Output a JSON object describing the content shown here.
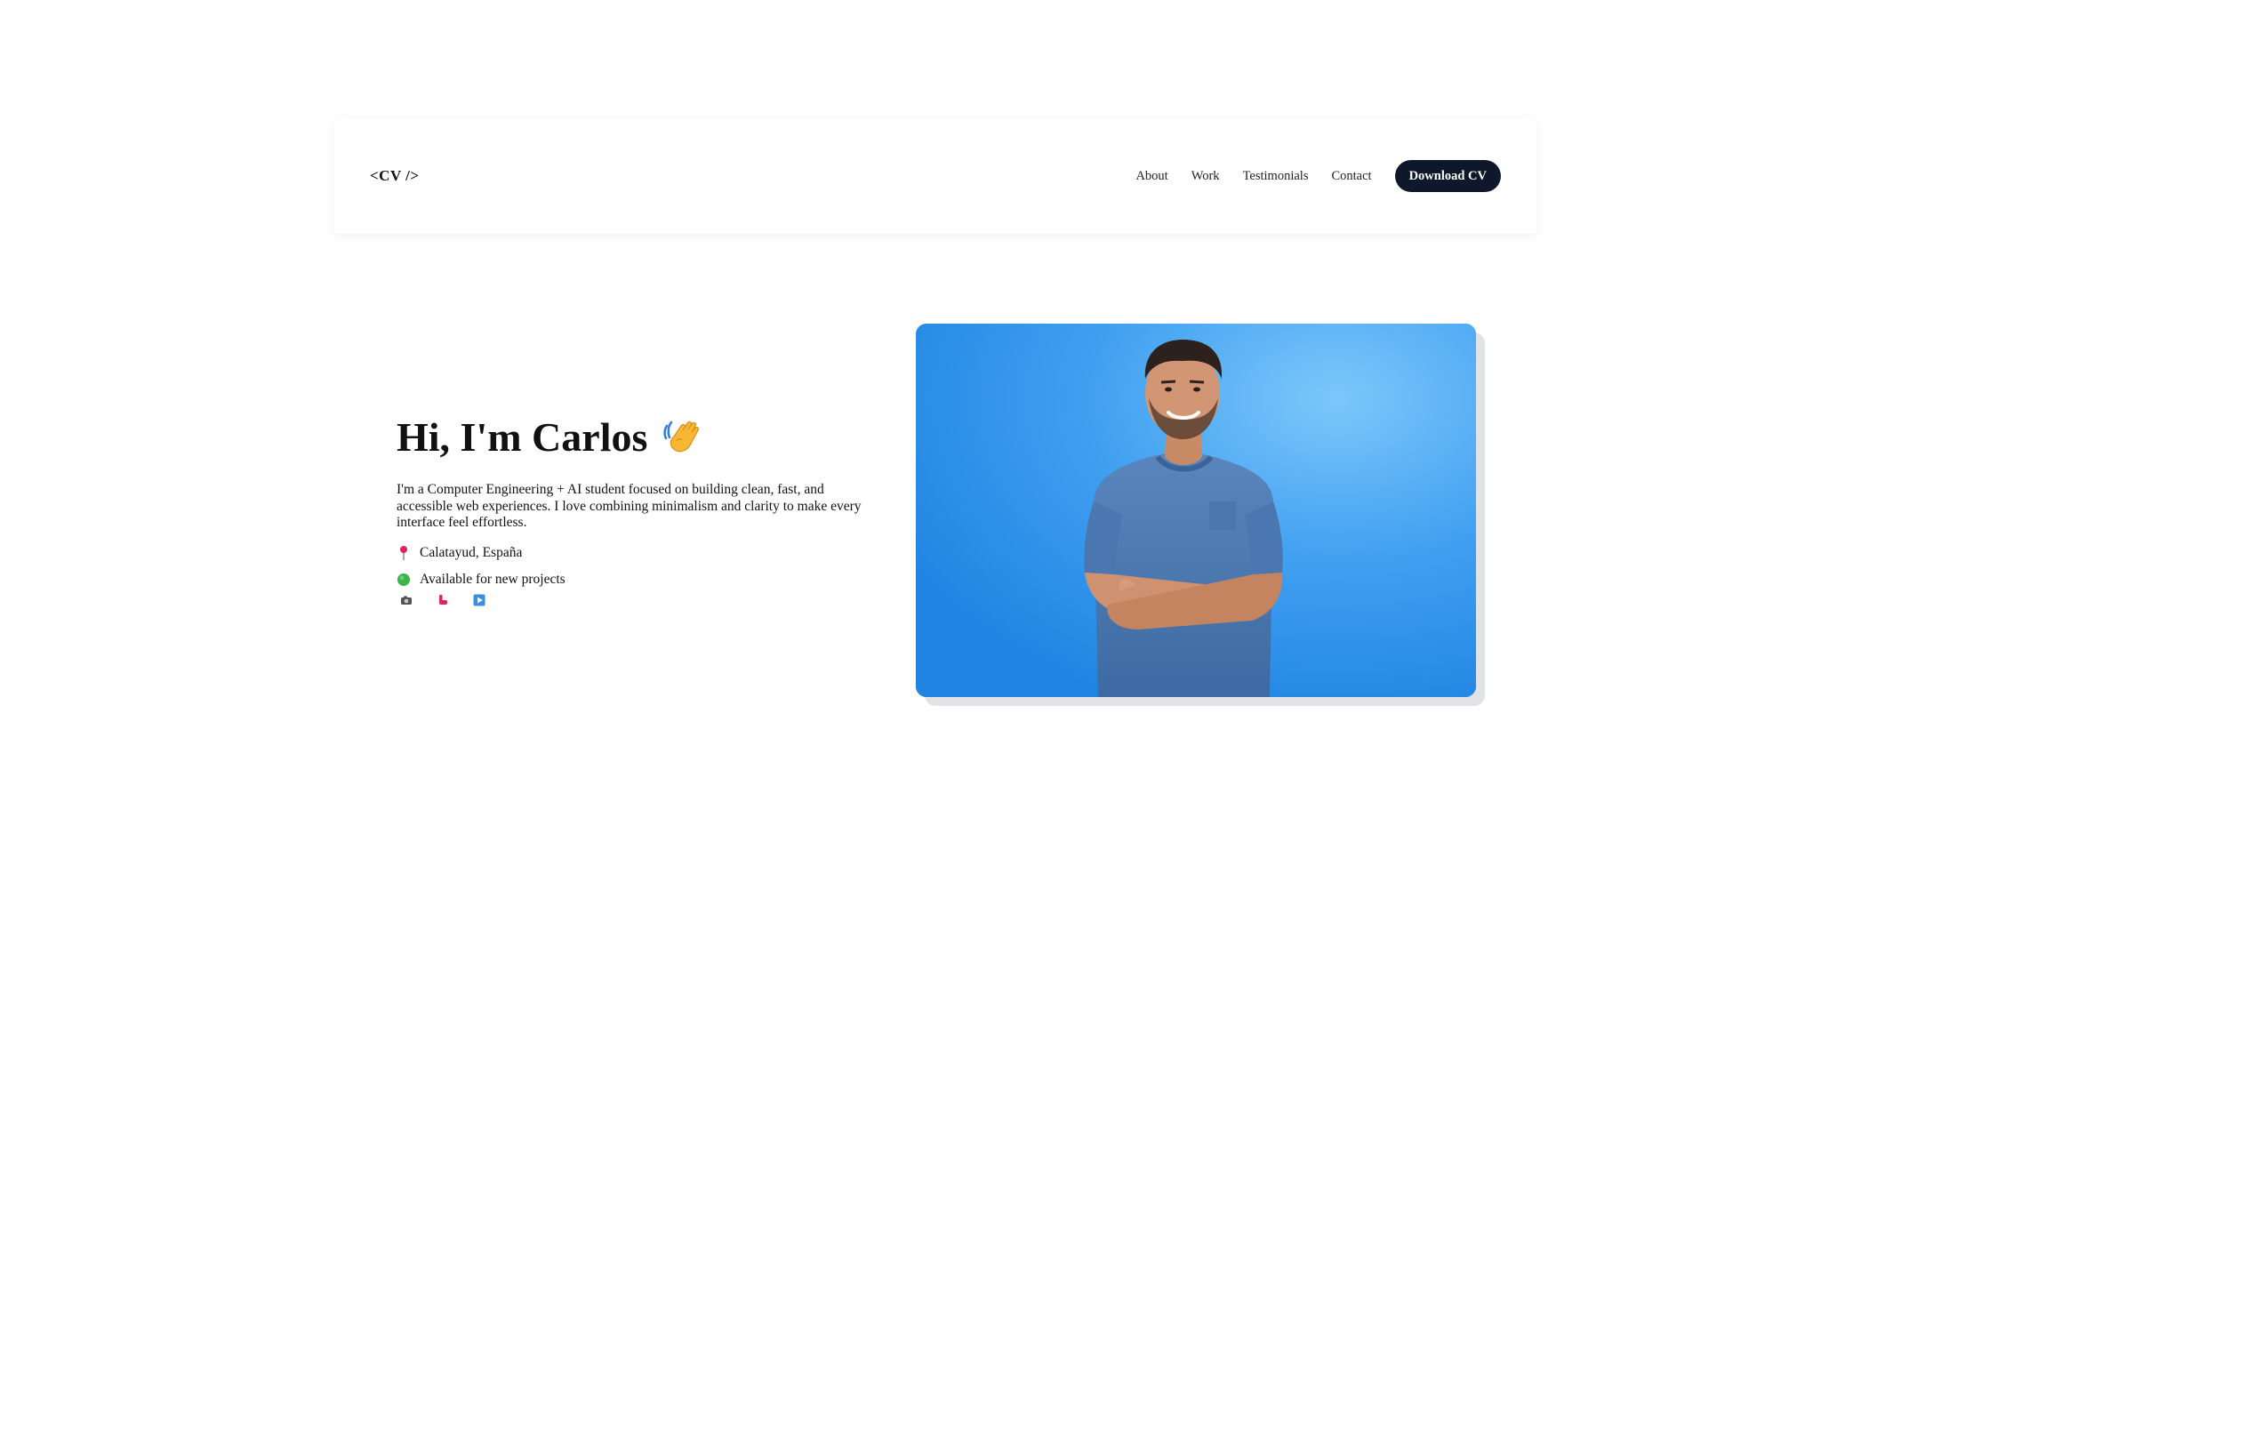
{
  "nav": {
    "logo": "<CV />",
    "links": [
      "About",
      "Work",
      "Testimonials",
      "Contact"
    ],
    "cta_label": "Download CV",
    "cta_color": "#0f172a"
  },
  "hero": {
    "title": "Hi, I'm Carlos",
    "title_emoji": "waving-hand-icon",
    "description": "I'm a Computer Engineering + AI student focused on building clean, fast, and accessible web experiences. I love combining minimalism and clarity to make every interface feel effortless.",
    "location": "Calatayud, España",
    "availability": "Available for new projects",
    "location_icon": "pin-icon",
    "availability_icon": "green-circle-icon",
    "socials": [
      "camera-icon",
      "instagram-icon",
      "play-icon"
    ],
    "photo_background": "#2f94ea"
  }
}
